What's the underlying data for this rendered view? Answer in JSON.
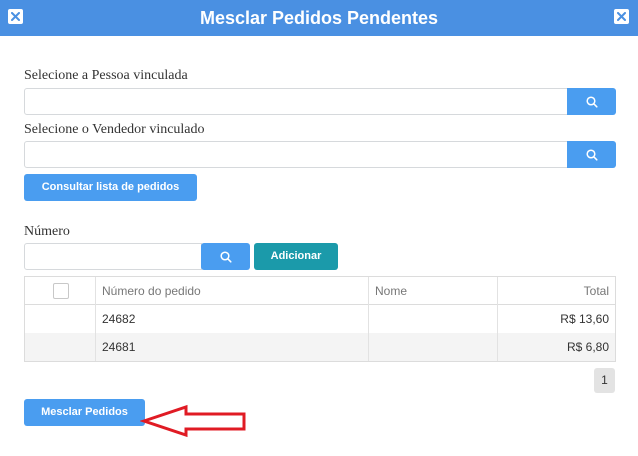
{
  "dialog": {
    "title": "Mesclar Pedidos Pendentes"
  },
  "icons": {
    "close": "close-icon",
    "search": "search-icon",
    "arrow": "arrow-left-annotation"
  },
  "colors": {
    "header": "#4a90e2",
    "primary_button": "#4a9df0",
    "add_button": "#1b9aaa",
    "annotation_arrow": "#e01b24"
  },
  "form": {
    "pessoa_label": "Selecione a Pessoa vinculada",
    "pessoa_value": "",
    "vendedor_label": "Selecione o Vendedor vinculado",
    "vendedor_value": "",
    "consultar_label": "Consultar lista de pedidos",
    "numero_label": "Número",
    "numero_value": "",
    "adicionar_label": "Adicionar"
  },
  "table": {
    "headers": [
      "",
      "Número do pedido",
      "Nome",
      "Total"
    ],
    "rows": [
      {
        "numero": "24682",
        "nome": "",
        "total": "R$ 13,60"
      },
      {
        "numero": "24681",
        "nome": "",
        "total": "R$ 6,80"
      }
    ]
  },
  "pagination": {
    "current_page": "1"
  },
  "footer": {
    "merge_label": "Mesclar Pedidos"
  }
}
